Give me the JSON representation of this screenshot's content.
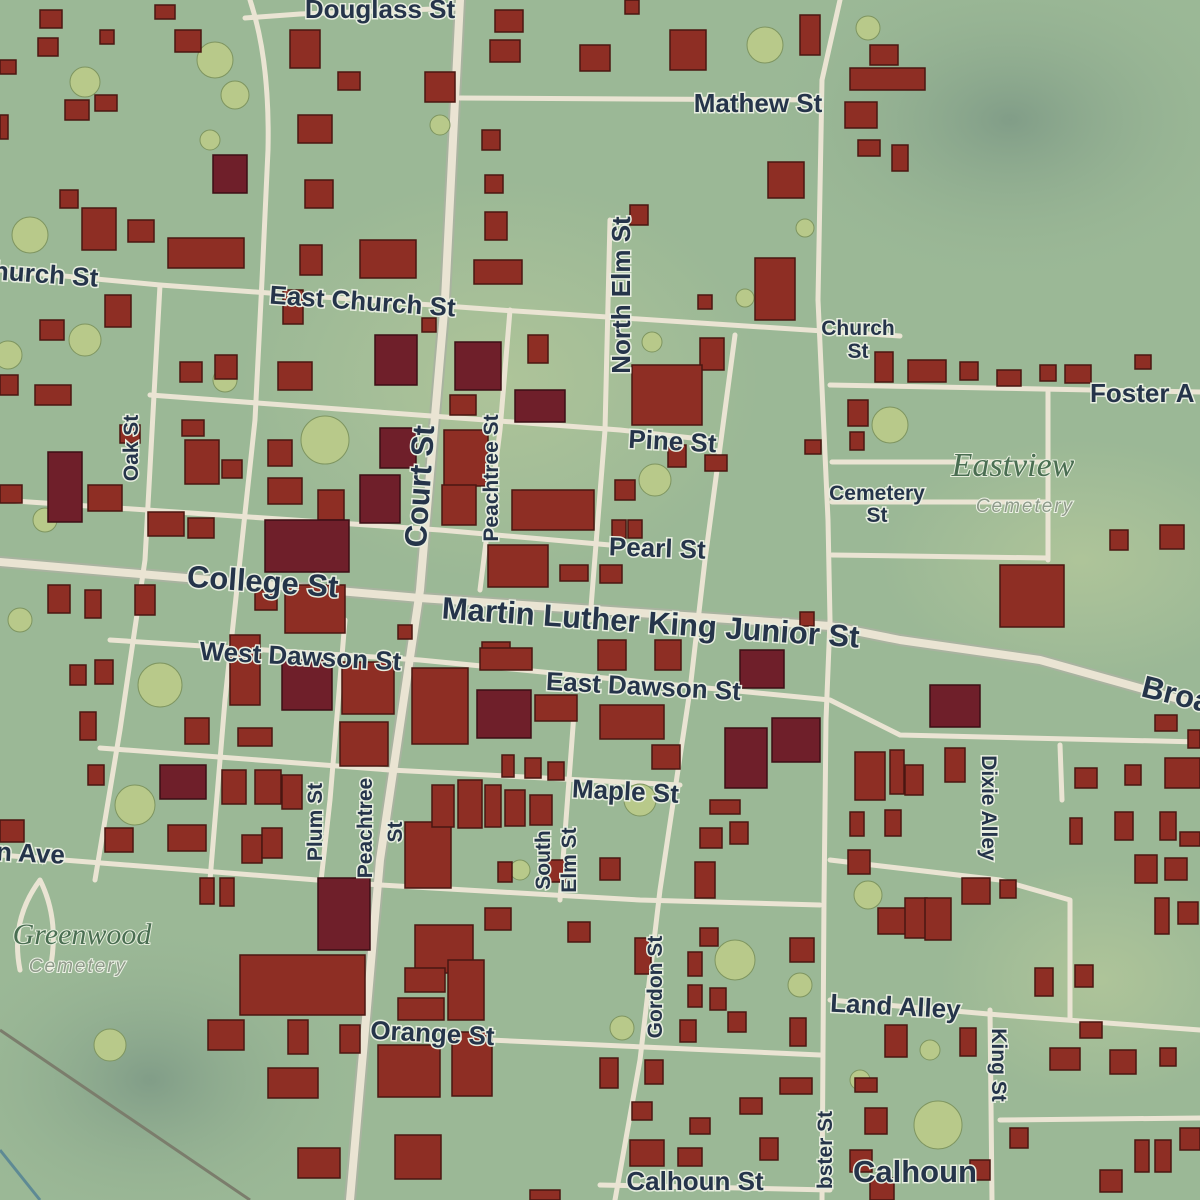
{
  "map": {
    "streets": [
      {
        "id": "douglass",
        "name": "Douglass St"
      },
      {
        "id": "mathew",
        "name": "Mathew St"
      },
      {
        "id": "church-w",
        "name": "hurch St"
      },
      {
        "id": "east-church",
        "name": "East Church St"
      },
      {
        "id": "church-e-1",
        "name": "Church"
      },
      {
        "id": "church-e-2",
        "name": "St"
      },
      {
        "id": "foster",
        "name": "Foster A"
      },
      {
        "id": "north-elm",
        "name": "North Elm St"
      },
      {
        "id": "oak",
        "name": "Oak St"
      },
      {
        "id": "peachtree-n",
        "name": "Peachtree St"
      },
      {
        "id": "pine",
        "name": "Pine St"
      },
      {
        "id": "court",
        "name": "Court St"
      },
      {
        "id": "cemetery-st-1",
        "name": "Cemetery"
      },
      {
        "id": "cemetery-st-2",
        "name": "St"
      },
      {
        "id": "pearl",
        "name": "Pearl St"
      },
      {
        "id": "college",
        "name": "College St"
      },
      {
        "id": "mlk",
        "name": "Martin Luther King Junior St"
      },
      {
        "id": "west-dawson",
        "name": "West Dawson St"
      },
      {
        "id": "east-dawson",
        "name": "East Dawson St"
      },
      {
        "id": "broad",
        "name": "Broa"
      },
      {
        "id": "dixie",
        "name": "Dixie Alley"
      },
      {
        "id": "maple",
        "name": "Maple St"
      },
      {
        "id": "plum",
        "name": "Plum St"
      },
      {
        "id": "peachtree-s-1",
        "name": "Peachtree"
      },
      {
        "id": "peachtree-s-2",
        "name": "St"
      },
      {
        "id": "south-elm-1",
        "name": "South"
      },
      {
        "id": "south-elm-2",
        "name": "Elm St"
      },
      {
        "id": "ave-w",
        "name": "n Ave"
      },
      {
        "id": "gordon",
        "name": "Gordon St"
      },
      {
        "id": "land-alley",
        "name": "Land Alley"
      },
      {
        "id": "king",
        "name": "King St"
      },
      {
        "id": "orange",
        "name": "Orange St"
      },
      {
        "id": "webster",
        "name": "bster St"
      },
      {
        "id": "calhoun-st",
        "name": "Calhoun St"
      },
      {
        "id": "calhoun-e",
        "name": "Calhoun"
      }
    ],
    "areas": [
      {
        "id": "eastview",
        "name": "Eastview",
        "sub": "Cemetery"
      },
      {
        "id": "greenwood",
        "name": "Greenwood",
        "sub": "Cemetery"
      }
    ],
    "colors": {
      "terrain": "#9bb896",
      "road": "#eae4d3",
      "building": "#8e2e24",
      "label": "#25344a",
      "area_label": "#4a6e52"
    }
  }
}
